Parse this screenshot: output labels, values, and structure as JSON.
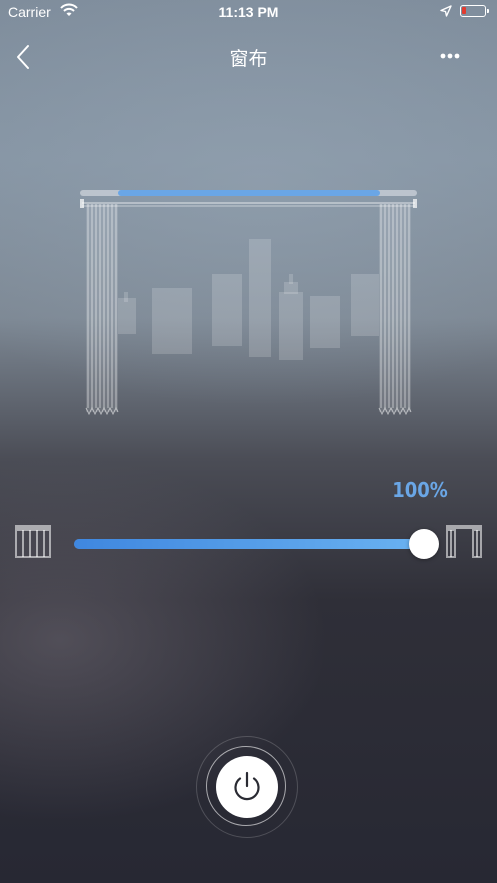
{
  "status_bar": {
    "carrier": "Carrier",
    "time": "11:13 PM",
    "battery_color": "#e23b2f"
  },
  "nav": {
    "title": "窗布",
    "back_icon": "chevron-left-icon",
    "more_icon": "more-horizontal-icon"
  },
  "curtain": {
    "open_percent_label": "100%",
    "open_fraction": 1.0,
    "accent_color": "#6aa6e6"
  },
  "controls": {
    "close_icon": "curtain-closed-icon",
    "open_icon": "curtain-open-icon",
    "power_icon": "power-icon"
  }
}
